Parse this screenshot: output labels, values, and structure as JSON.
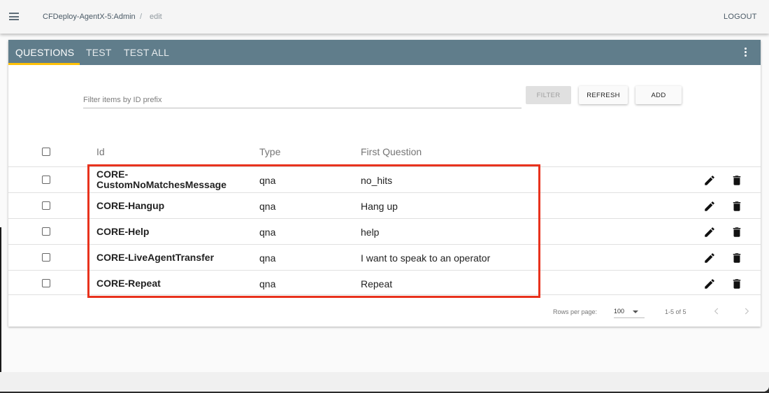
{
  "header": {
    "breadcrumb_main": "CFDeploy-AgentX-5:Admin",
    "breadcrumb_sep": "/",
    "breadcrumb_sub": "edit",
    "logout_label": "LOGOUT",
    "menu_icon": "menu-icon"
  },
  "tabs": [
    {
      "label": "QUESTIONS",
      "active": true
    },
    {
      "label": "TEST",
      "active": false
    },
    {
      "label": "TEST ALL",
      "active": false
    }
  ],
  "colors": {
    "tabbar": "#607d8b",
    "active_indicator": "#ffc107",
    "highlight": "#e8321d"
  },
  "filter": {
    "placeholder": "Filter items by ID prefix",
    "value": "",
    "filter_label": "FILTER",
    "refresh_label": "REFRESH",
    "add_label": "ADD"
  },
  "table": {
    "columns": {
      "id": "Id",
      "type": "Type",
      "first_question": "First Question"
    },
    "rows": [
      {
        "id": "CORE-\nCustomNoMatchesMessage",
        "type": "qna",
        "first_question": "no_hits"
      },
      {
        "id": "CORE-Hangup",
        "type": "qna",
        "first_question": "Hang up"
      },
      {
        "id": "CORE-Help",
        "type": "qna",
        "first_question": "help"
      },
      {
        "id": "CORE-LiveAgentTransfer",
        "type": "qna",
        "first_question": "I want to speak to an operator"
      },
      {
        "id": "CORE-Repeat",
        "type": "qna",
        "first_question": "Repeat"
      }
    ]
  },
  "pagination": {
    "rows_per_page_label": "Rows per page:",
    "rows_per_page_value": "100",
    "range": "1-5 of 5"
  }
}
